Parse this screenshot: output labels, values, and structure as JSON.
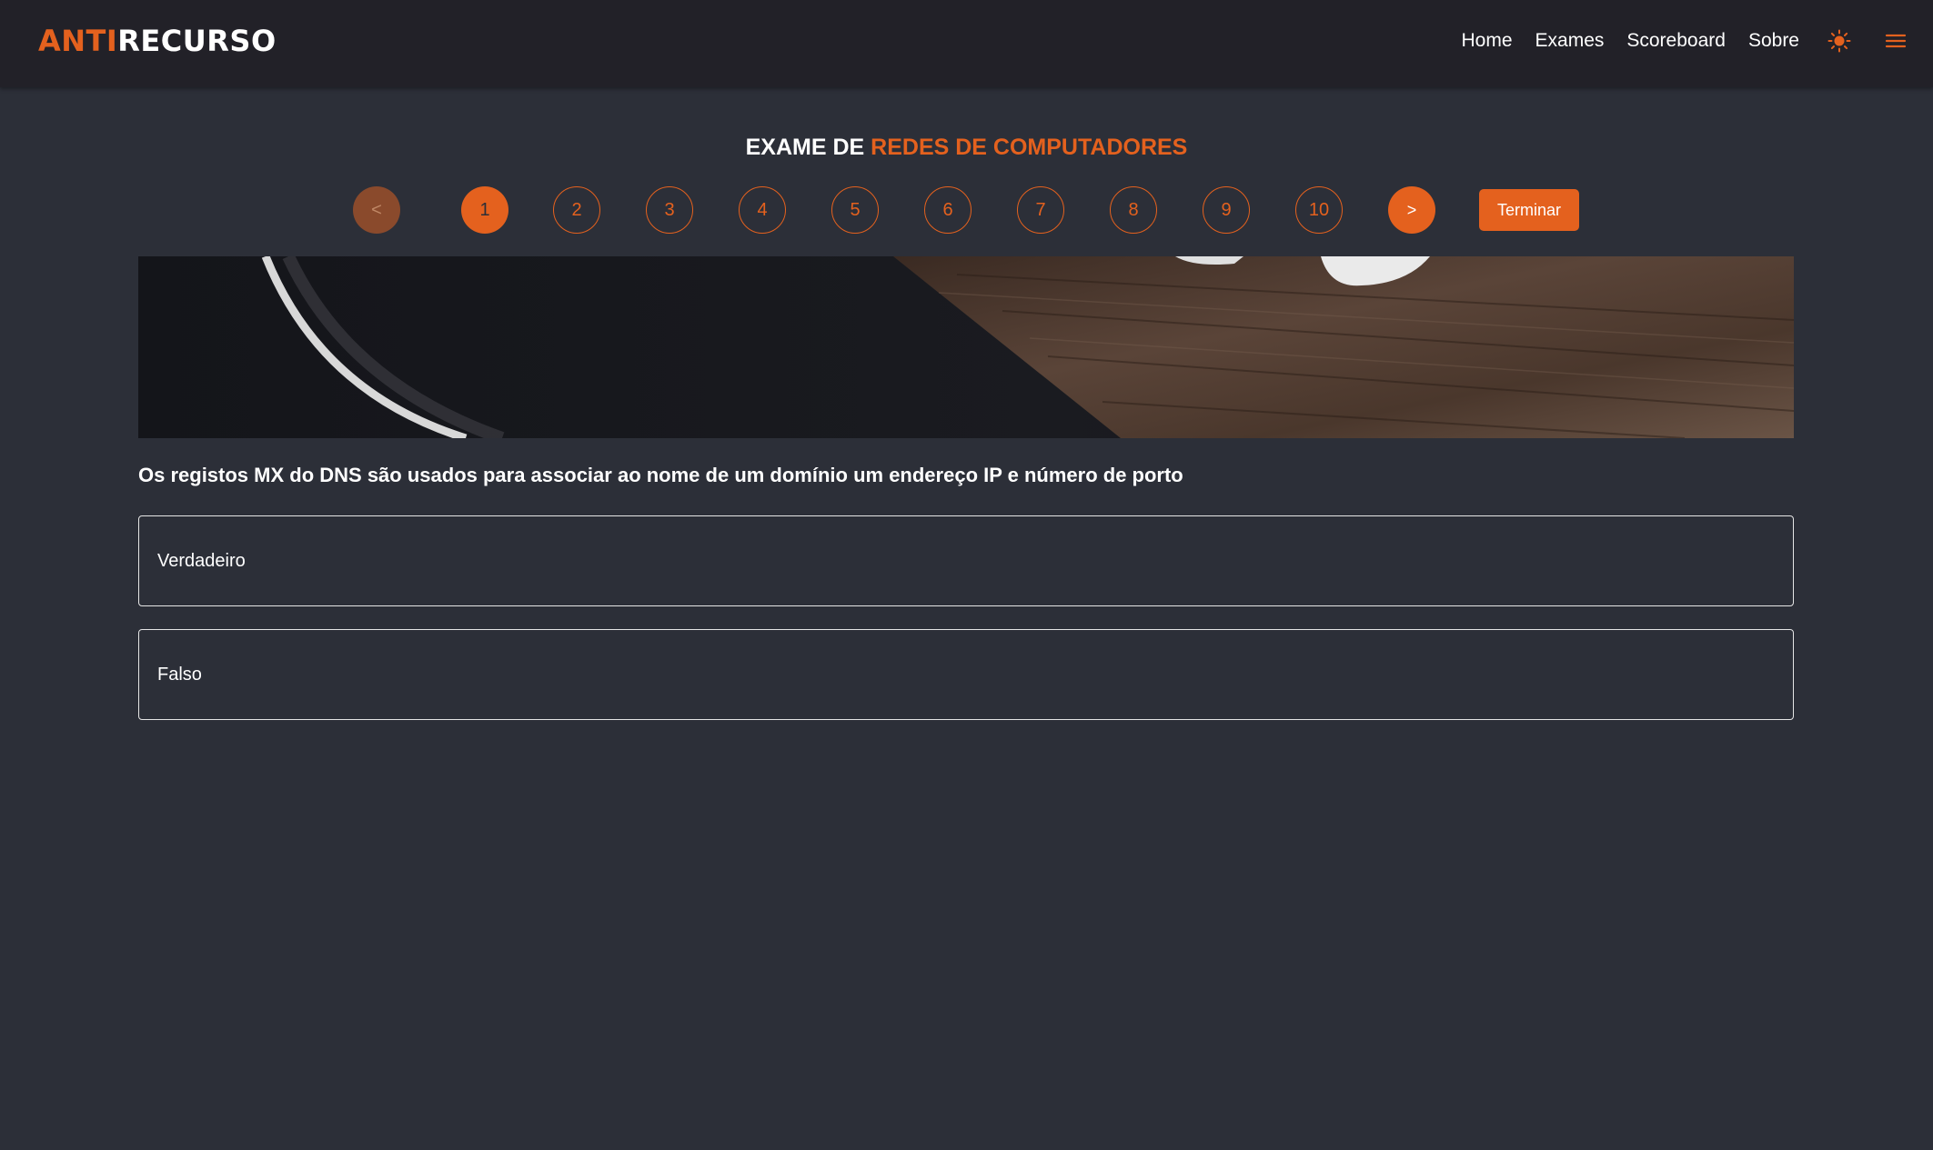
{
  "brand": {
    "part1": "ANTI",
    "part2": "RECURSO"
  },
  "nav": {
    "links": [
      "Home",
      "Exames",
      "Scoreboard",
      "Sobre"
    ],
    "theme_icon": "sun-icon",
    "menu_icon": "hamburger-menu-icon"
  },
  "exam": {
    "title_prefix": "EXAME DE",
    "title_subject": "REDES DE COMPUTADORES"
  },
  "pager": {
    "prev_label": "<",
    "next_label": ">",
    "pages": [
      "1",
      "2",
      "3",
      "4",
      "5",
      "6",
      "7",
      "8",
      "9",
      "10"
    ],
    "current_page": "1",
    "finish_label": "Terminar"
  },
  "question": {
    "text": "Os registos MX do DNS são usados para associar ao nome de um domínio um endereço IP e número de porto",
    "options": [
      "Verdadeiro",
      "Falso"
    ]
  },
  "colors": {
    "accent": "#e4611e",
    "background": "#2c2f38",
    "navbar": "#222128"
  }
}
